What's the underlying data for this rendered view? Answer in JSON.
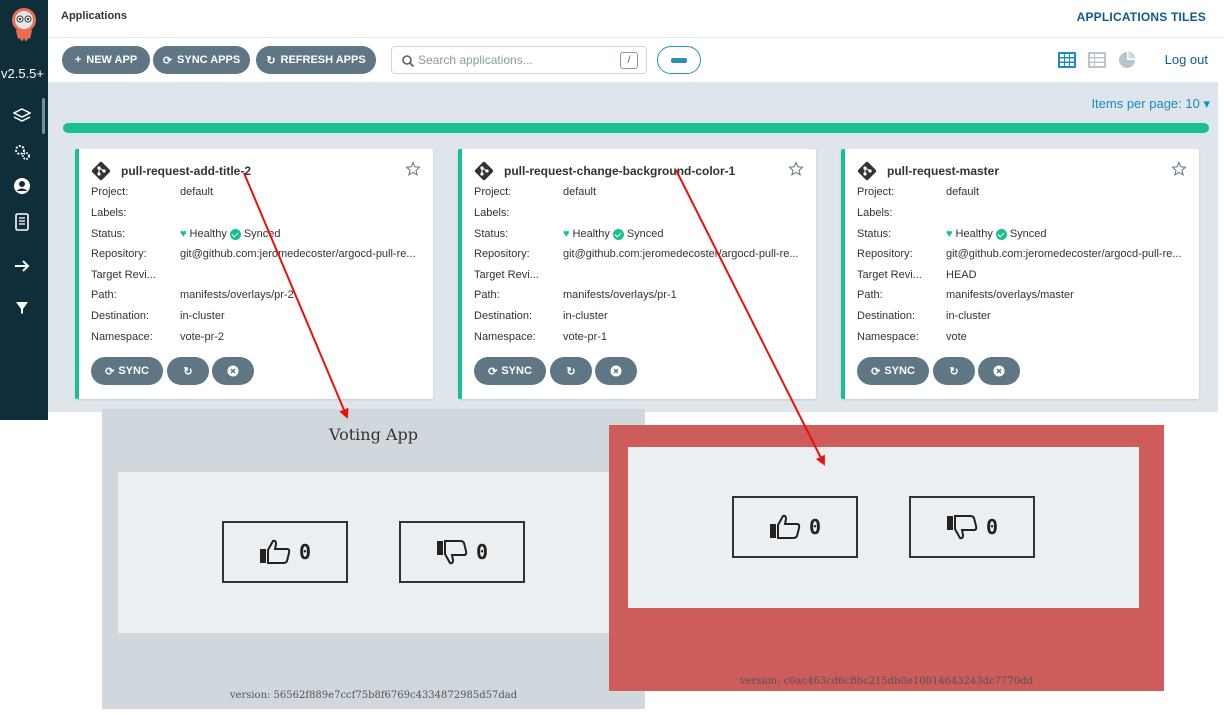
{
  "sidebar": {
    "version": "v2.5.5+",
    "icons": [
      "layers-icon",
      "gears-icon",
      "user-icon",
      "docs-icon",
      "arrow-right-icon",
      "filter-icon"
    ]
  },
  "topbar": {
    "breadcrumb": "Applications",
    "view_title": "APPLICATIONS TILES"
  },
  "toolbar": {
    "new_app": "NEW APP",
    "sync_apps": "SYNC APPS",
    "refresh_apps": "REFRESH APPS",
    "search_placeholder": "Search applications...",
    "search_shortcut": "/",
    "logout": "Log out"
  },
  "pagination": {
    "items_per_page": "Items per page: 10"
  },
  "labels": {
    "project": "Project:",
    "labels": "Labels:",
    "status": "Status:",
    "repository": "Repository:",
    "target_revision": "Target Revi...",
    "path": "Path:",
    "destination": "Destination:",
    "namespace": "Namespace:",
    "healthy": "Healthy",
    "synced": "Synced",
    "sync_btn": "SYNC"
  },
  "apps": [
    {
      "name": "pull-request-add-title-2",
      "project": "default",
      "labels": "",
      "repository": "git@github.com:jeromedecoster/argocd-pull-re...",
      "target_revision": "",
      "path": "manifests/overlays/pr-2",
      "destination": "in-cluster",
      "namespace": "vote-pr-2"
    },
    {
      "name": "pull-request-change-background-color-1",
      "project": "default",
      "labels": "",
      "repository": "git@github.com:jeromedecoster/argocd-pull-re...",
      "target_revision": "",
      "path": "manifests/overlays/pr-1",
      "destination": "in-cluster",
      "namespace": "vote-pr-1"
    },
    {
      "name": "pull-request-master",
      "project": "default",
      "labels": "",
      "repository": "git@github.com:jeromedecoster/argocd-pull-re...",
      "target_revision": "HEAD",
      "path": "manifests/overlays/master",
      "destination": "in-cluster",
      "namespace": "vote"
    }
  ],
  "voting_a": {
    "title": "Voting App",
    "up_count": "0",
    "down_count": "0",
    "version": "version: 56562f889e7ccf75b8f6769c4334872985d57dad"
  },
  "voting_b": {
    "up_count": "0",
    "down_count": "0",
    "version": "version: c0ac463cd6c8bc215db0e10014643243dc7770dd",
    "background": "#cd5c5a"
  },
  "colors": {
    "sidebar": "#0f2e3a",
    "accent_green": "#18be94",
    "button_gray": "#5f7684",
    "link_blue": "#0f5b8a",
    "arrow_red": "#e8120c"
  }
}
